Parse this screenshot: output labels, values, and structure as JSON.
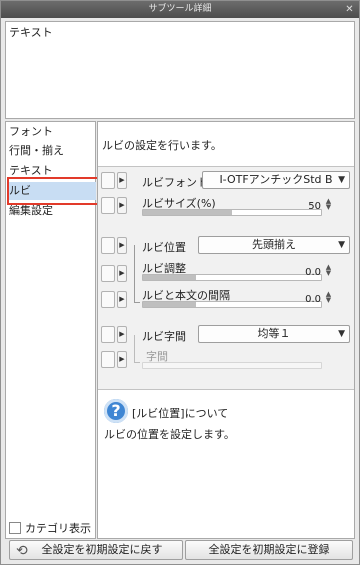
{
  "window": {
    "title": "サブツール詳細",
    "close_glyph": "✕"
  },
  "preview": {
    "text": "テキスト"
  },
  "categories": {
    "items": [
      {
        "label": "フォント"
      },
      {
        "label": "行間・揃え"
      },
      {
        "label": "テキスト"
      },
      {
        "label": "ルビ"
      },
      {
        "label": "編集設定"
      }
    ],
    "selected_index": 3,
    "show_category_label": "カテゴリ表示"
  },
  "panel": {
    "description": "ルビの設定を行います。",
    "ruby_font": {
      "label": "ルビフォント",
      "value": "I-OTFアンチックStd B"
    },
    "ruby_size": {
      "label": "ルビサイズ(%)",
      "value": "50",
      "fraction": 0.5
    },
    "ruby_position": {
      "label": "ルビ位置",
      "value": "先頭揃え"
    },
    "ruby_adjust": {
      "label": "ルビ調整",
      "value": "0.0",
      "fraction": 0.3
    },
    "ruby_gap": {
      "label": "ルビと本文の間隔",
      "value": "0.0",
      "fraction": 0.3
    },
    "ruby_spacing": {
      "label": "ルビ字間",
      "value": "均等１"
    },
    "char_spacing": {
      "label": "字間"
    }
  },
  "help": {
    "title": "[ルビ位置]について",
    "body": "ルビの位置を設定します。",
    "icon": "question-icon"
  },
  "buttons": {
    "reset_label": "全設定を初期設定に戻す",
    "register_label": "全設定を初期設定に登録"
  }
}
